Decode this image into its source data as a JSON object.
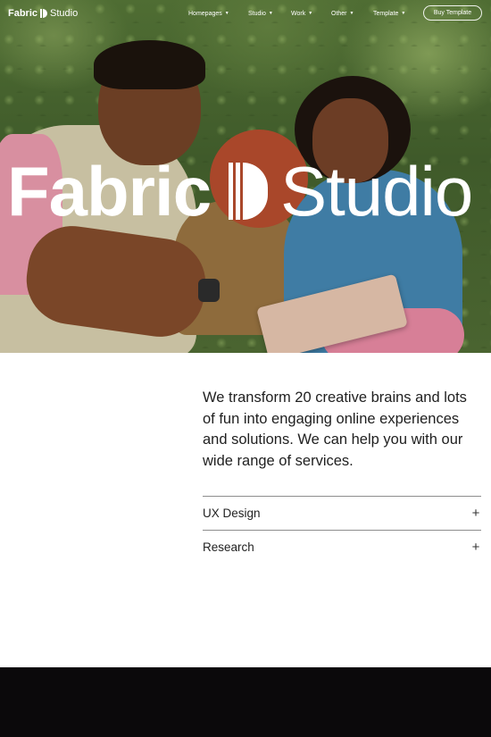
{
  "brand": {
    "bold": "Fabric",
    "light": "Studio"
  },
  "nav": {
    "items": [
      {
        "label": "Homepages"
      },
      {
        "label": "Studio"
      },
      {
        "label": "Work"
      },
      {
        "label": "Other"
      },
      {
        "label": "Template"
      }
    ],
    "cta_label": "Buy Template",
    "chevron_icon": "chevron-down-icon"
  },
  "hero": {
    "logo_bold": "Fabric",
    "logo_light": "Studio",
    "image": "photo of three people laughing in front of a green hedge"
  },
  "intro": {
    "text": "We transform 20 creative brains and lots of fun into engaging online experiences and solutions. We can help you with our wide range of services."
  },
  "services": [
    {
      "label": "UX Design",
      "icon": "+"
    },
    {
      "label": "Research",
      "icon": "+"
    }
  ],
  "colors": {
    "footer_bg": "#0b090b",
    "text": "#1f1f1f",
    "divider": "#8e8e8e"
  }
}
